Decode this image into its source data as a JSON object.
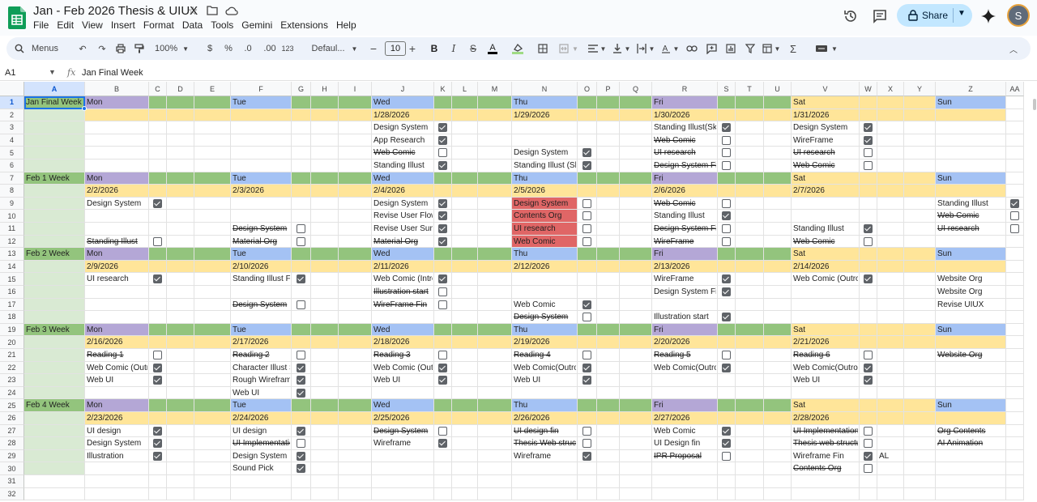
{
  "doc": {
    "title": "Jan - Feb 2026 Thesis & UIUX"
  },
  "menu": [
    "File",
    "Edit",
    "View",
    "Insert",
    "Format",
    "Data",
    "Tools",
    "Gemini",
    "Extensions",
    "Help"
  ],
  "toolbar": {
    "menus_label": "Menus",
    "zoom": "100%",
    "currency": "$",
    "percent": "%",
    "dec_dec": ".0",
    "inc_dec": ".00",
    "num_format": "123",
    "font": "Defaul...",
    "font_size": "10"
  },
  "share": {
    "label": "Share"
  },
  "avatar": {
    "initial": "S"
  },
  "formula": {
    "cell_ref": "A1",
    "fx": "fx",
    "value": "Jan Final Week"
  },
  "colors": {
    "green": "#93c47d",
    "purple": "#b4a7d6",
    "blue": "#a4c2f4",
    "yellow": "#ffe599",
    "light_green": "#d9ead3",
    "red": "#e06666",
    "accent": "#1a73e8"
  },
  "columns": [
    "A",
    "B",
    "C",
    "D",
    "E",
    "F",
    "G",
    "H",
    "I",
    "J",
    "K",
    "L",
    "M",
    "N",
    "O",
    "P",
    "Q",
    "R",
    "S",
    "T",
    "U",
    "V",
    "W",
    "X",
    "Y",
    "Z",
    "AA"
  ],
  "rows": [
    "1",
    "2",
    "3",
    "4",
    "5",
    "6",
    "7",
    "8",
    "9",
    "10",
    "11",
    "12",
    "13",
    "14",
    "15",
    "16",
    "17",
    "18",
    "19",
    "20",
    "21",
    "22",
    "23",
    "24",
    "25",
    "26",
    "27",
    "28",
    "29",
    "30",
    "31",
    "32"
  ],
  "weeks": [
    {
      "row": 1,
      "label": "Jan Final Week",
      "days": [
        "Mon",
        "Tue",
        "Wed",
        "Thu",
        "Fri",
        "Sat",
        "Sun"
      ],
      "dates": [
        "",
        "",
        "1/28/2026",
        "1/29/2026",
        "1/30/2026",
        "1/31/2026",
        ""
      ]
    },
    {
      "row": 7,
      "label": "Feb 1 Week",
      "days": [
        "Mon",
        "Tue",
        "Wed",
        "Thu",
        "Fri",
        "Sat",
        "Sun"
      ],
      "dates": [
        "2/2/2026",
        "2/3/2026",
        "2/4/2026",
        "2/5/2026",
        "2/6/2026",
        "2/7/2026",
        ""
      ]
    },
    {
      "row": 13,
      "label": "Feb 2 Week",
      "days": [
        "Mon",
        "Tue",
        "Wed",
        "Thu",
        "Fri",
        "Sat",
        "Sun"
      ],
      "dates": [
        "2/9/2026",
        "2/10/2026",
        "2/11/2026",
        "2/12/2026",
        "2/13/2026",
        "2/14/2026",
        ""
      ]
    },
    {
      "row": 19,
      "label": "Feb 3 Week",
      "days": [
        "Mon",
        "Tue",
        "Wed",
        "Thu",
        "Fri",
        "Sat",
        "Sun"
      ],
      "dates": [
        "2/16/2026",
        "2/17/2026",
        "2/18/2026",
        "2/19/2026",
        "2/20/2026",
        "2/21/2026",
        ""
      ]
    },
    {
      "row": 25,
      "label": "Feb 4 Week",
      "days": [
        "Mon",
        "Tue",
        "Wed",
        "Thu",
        "Fri",
        "Sat",
        "Sun"
      ],
      "dates": [
        "2/23/2026",
        "2/24/2026",
        "2/25/2026",
        "2/26/2026",
        "2/27/2026",
        "2/28/2026",
        ""
      ]
    }
  ],
  "tasks": [
    {
      "row": 3,
      "day": 2,
      "text": "Design System",
      "strike": false,
      "checked": true
    },
    {
      "row": 4,
      "day": 2,
      "text": "App Research",
      "strike": false,
      "checked": true
    },
    {
      "row": 5,
      "day": 2,
      "text": "Web Comic",
      "strike": true,
      "checked": false
    },
    {
      "row": 6,
      "day": 2,
      "text": "Standing Illust",
      "strike": false,
      "checked": true
    },
    {
      "row": 5,
      "day": 3,
      "text": "Design System",
      "strike": false,
      "checked": true
    },
    {
      "row": 6,
      "day": 3,
      "text": "Standing Illust (Sk",
      "strike": false,
      "checked": true
    },
    {
      "row": 3,
      "day": 4,
      "text": "Standing Illust(Sk",
      "strike": false,
      "checked": true
    },
    {
      "row": 4,
      "day": 4,
      "text": "Web Comic",
      "strike": true,
      "checked": false
    },
    {
      "row": 5,
      "day": 4,
      "text": "UI research",
      "strike": true,
      "checked": false
    },
    {
      "row": 6,
      "day": 4,
      "text": "Design System Fi",
      "strike": true,
      "checked": false
    },
    {
      "row": 3,
      "day": 5,
      "text": "Design System",
      "strike": false,
      "checked": true
    },
    {
      "row": 4,
      "day": 5,
      "text": "WireFrame",
      "strike": false,
      "checked": true
    },
    {
      "row": 5,
      "day": 5,
      "text": "UI research",
      "strike": true,
      "checked": false
    },
    {
      "row": 6,
      "day": 5,
      "text": "Web Comic",
      "strike": true,
      "checked": false
    },
    {
      "row": 9,
      "day": 0,
      "text": "Design System",
      "strike": false,
      "checked": true
    },
    {
      "row": 12,
      "day": 0,
      "text": "Standing Illust",
      "strike": true,
      "checked": false
    },
    {
      "row": 11,
      "day": 1,
      "text": "Design System",
      "strike": true,
      "checked": false
    },
    {
      "row": 12,
      "day": 1,
      "text": "Material Org",
      "strike": true,
      "checked": false
    },
    {
      "row": 9,
      "day": 2,
      "text": "Design System",
      "strike": false,
      "checked": true
    },
    {
      "row": 10,
      "day": 2,
      "text": "Revise User Flow",
      "strike": false,
      "checked": true
    },
    {
      "row": 11,
      "day": 2,
      "text": "Revise User Sum",
      "strike": false,
      "checked": true
    },
    {
      "row": 12,
      "day": 2,
      "text": "Material Org",
      "strike": true,
      "checked": true
    },
    {
      "row": 9,
      "day": 3,
      "text": "Design System",
      "strike": false,
      "checked": false,
      "red": true
    },
    {
      "row": 10,
      "day": 3,
      "text": "Contents Org",
      "strike": false,
      "checked": false,
      "red": true
    },
    {
      "row": 11,
      "day": 3,
      "text": "UI research",
      "strike": false,
      "checked": false,
      "red": true
    },
    {
      "row": 12,
      "day": 3,
      "text": "Web Comic",
      "strike": false,
      "checked": false,
      "red": true
    },
    {
      "row": 9,
      "day": 4,
      "text": "Web Comic",
      "strike": true,
      "checked": false
    },
    {
      "row": 10,
      "day": 4,
      "text": "Standing Illust",
      "strike": false,
      "checked": true
    },
    {
      "row": 11,
      "day": 4,
      "text": "Design System Fi",
      "strike": true,
      "checked": false
    },
    {
      "row": 12,
      "day": 4,
      "text": "WireFrame",
      "strike": true,
      "checked": false
    },
    {
      "row": 11,
      "day": 5,
      "text": "Standing Illust",
      "strike": false,
      "checked": true
    },
    {
      "row": 12,
      "day": 5,
      "text": "Web Comic",
      "strike": true,
      "checked": false
    },
    {
      "row": 9,
      "day": 6,
      "text": "Standing Illust",
      "strike": false,
      "checked": true
    },
    {
      "row": 10,
      "day": 6,
      "text": "Web Comic",
      "strike": true,
      "checked": false
    },
    {
      "row": 11,
      "day": 6,
      "text": "UI research",
      "strike": true,
      "checked": false
    },
    {
      "row": 15,
      "day": 0,
      "text": "UI research",
      "strike": false,
      "checked": true
    },
    {
      "row": 15,
      "day": 1,
      "text": "Standing Illust F",
      "strike": false,
      "checked": true
    },
    {
      "row": 17,
      "day": 1,
      "text": "Design System",
      "strike": true,
      "checked": false
    },
    {
      "row": 15,
      "day": 2,
      "text": "Web Comic (Intro",
      "strike": false,
      "checked": true
    },
    {
      "row": 16,
      "day": 2,
      "text": "Illustration start",
      "strike": true,
      "checked": false
    },
    {
      "row": 17,
      "day": 2,
      "text": "WireFrame Fin",
      "strike": true,
      "checked": false
    },
    {
      "row": 17,
      "day": 3,
      "text": "Web Comic",
      "strike": false,
      "checked": true
    },
    {
      "row": 18,
      "day": 3,
      "text": "Design System",
      "strike": true,
      "checked": false
    },
    {
      "row": 15,
      "day": 4,
      "text": "WireFrame",
      "strike": false,
      "checked": true
    },
    {
      "row": 16,
      "day": 4,
      "text": "Design System Fi",
      "strike": false,
      "checked": true
    },
    {
      "row": 18,
      "day": 4,
      "text": "Illustration start",
      "strike": false,
      "checked": true
    },
    {
      "row": 15,
      "day": 5,
      "text": "Web Comic (Outro",
      "strike": false,
      "checked": true
    },
    {
      "row": 15,
      "day": 6,
      "text": "Website Org",
      "strike": false
    },
    {
      "row": 16,
      "day": 6,
      "text": "Website Org",
      "strike": false
    },
    {
      "row": 17,
      "day": 6,
      "text": "Revise UIUX",
      "strike": false
    },
    {
      "row": 21,
      "day": 0,
      "text": "Reading 1",
      "strike": true,
      "checked": false
    },
    {
      "row": 22,
      "day": 0,
      "text": "Web Comic (Outro",
      "strike": false,
      "checked": true
    },
    {
      "row": 23,
      "day": 0,
      "text": "Web UI",
      "strike": false,
      "checked": true
    },
    {
      "row": 21,
      "day": 1,
      "text": "Reading 2",
      "strike": true,
      "checked": false
    },
    {
      "row": 22,
      "day": 1,
      "text": "Character Illust S",
      "strike": false,
      "checked": true
    },
    {
      "row": 23,
      "day": 1,
      "text": "Rough Wirefram",
      "strike": false,
      "checked": true
    },
    {
      "row": 24,
      "day": 1,
      "text": "Web UI",
      "strike": false,
      "checked": true
    },
    {
      "row": 21,
      "day": 2,
      "text": "Reading 3",
      "strike": true,
      "checked": false
    },
    {
      "row": 22,
      "day": 2,
      "text": "Web Comic (Outro",
      "strike": false,
      "checked": true
    },
    {
      "row": 23,
      "day": 2,
      "text": "Web UI",
      "strike": false,
      "checked": true
    },
    {
      "row": 21,
      "day": 3,
      "text": "Reading 4",
      "strike": true,
      "checked": false
    },
    {
      "row": 22,
      "day": 3,
      "text": "Web Comic(Outro",
      "strike": false,
      "checked": true
    },
    {
      "row": 23,
      "day": 3,
      "text": "Web UI",
      "strike": false,
      "checked": true
    },
    {
      "row": 21,
      "day": 4,
      "text": "Reading 5",
      "strike": true,
      "checked": false
    },
    {
      "row": 22,
      "day": 4,
      "text": "Web Comic(Outro",
      "strike": false,
      "checked": true
    },
    {
      "row": 21,
      "day": 5,
      "text": "Reading 6",
      "strike": true,
      "checked": false
    },
    {
      "row": 22,
      "day": 5,
      "text": "Web Comic(Outro)",
      "strike": false,
      "checked": true
    },
    {
      "row": 23,
      "day": 5,
      "text": "Web UI",
      "strike": false,
      "checked": true
    },
    {
      "row": 21,
      "day": 6,
      "text": "Website Org",
      "strike": true
    },
    {
      "row": 27,
      "day": 0,
      "text": "UI design",
      "strike": false,
      "checked": true
    },
    {
      "row": 28,
      "day": 0,
      "text": "Design System",
      "strike": false,
      "checked": true
    },
    {
      "row": 29,
      "day": 0,
      "text": "Illustration",
      "strike": false,
      "checked": true
    },
    {
      "row": 27,
      "day": 1,
      "text": "UI design",
      "strike": false,
      "checked": true
    },
    {
      "row": 28,
      "day": 1,
      "text": "UI Implementatio",
      "strike": true,
      "checked": false
    },
    {
      "row": 29,
      "day": 1,
      "text": "Design System",
      "strike": false,
      "checked": true
    },
    {
      "row": 30,
      "day": 1,
      "text": "Sound Pick",
      "strike": false,
      "checked": true
    },
    {
      "row": 27,
      "day": 2,
      "text": "Design System",
      "strike": true,
      "checked": false
    },
    {
      "row": 28,
      "day": 2,
      "text": "Wireframe",
      "strike": false,
      "checked": true
    },
    {
      "row": 27,
      "day": 3,
      "text": "UI design fin",
      "strike": true,
      "checked": false
    },
    {
      "row": 28,
      "day": 3,
      "text": "Thesis Web struct",
      "strike": true,
      "checked": false
    },
    {
      "row": 29,
      "day": 3,
      "text": "Wireframe",
      "strike": false,
      "checked": true
    },
    {
      "row": 27,
      "day": 4,
      "text": "Web Comic",
      "strike": false,
      "checked": true
    },
    {
      "row": 28,
      "day": 4,
      "text": "UI Design fin",
      "strike": false,
      "checked": true
    },
    {
      "row": 29,
      "day": 4,
      "text": "IPR Proposal",
      "strike": true,
      "checked": false
    },
    {
      "row": 27,
      "day": 5,
      "text": "UI Implementation",
      "strike": true,
      "checked": false
    },
    {
      "row": 28,
      "day": 5,
      "text": "Thesis web structu",
      "strike": true,
      "checked": false
    },
    {
      "row": 29,
      "day": 5,
      "text": "Wireframe Fin",
      "strike": false,
      "checked": true
    },
    {
      "row": 30,
      "day": 5,
      "text": "Contents Org",
      "strike": true,
      "checked": false
    },
    {
      "row": 27,
      "day": 6,
      "text": "Org Contents",
      "strike": true
    },
    {
      "row": 28,
      "day": 6,
      "text": "AI Animation",
      "strike": true
    }
  ],
  "extra_cells": [
    {
      "row": 29,
      "col": "X",
      "text": "AL"
    }
  ],
  "sun_checkboxes": [
    {
      "row": 9,
      "checked": true
    },
    {
      "row": 10,
      "checked": false
    },
    {
      "row": 11,
      "checked": false
    }
  ]
}
